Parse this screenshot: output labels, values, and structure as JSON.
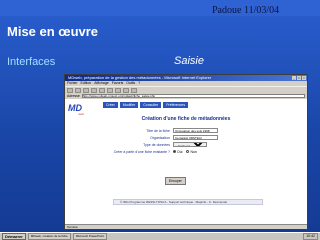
{
  "slide": {
    "stamp": "Padoue   11/03/04",
    "title": "Mise en œuvre",
    "subtitle": "Interfaces",
    "section": "Saisie"
  },
  "browser": {
    "title": "MDweb, préparation de la gestion des métadonnées - Microsoft Internet Explorer",
    "menu": [
      "Fichier",
      "Edition",
      "Affichage",
      "Favoris",
      "Outils",
      "?"
    ],
    "address_label": "Adresse",
    "address": "http://www.mdweb-project.org/mdweb/fiche_saisie.php",
    "status": "Terminé"
  },
  "app": {
    "logo_main": "MD",
    "logo_sub": "web",
    "nav": [
      "Créer",
      "Modifier",
      "Consulter",
      "Préférences"
    ],
    "form_title": "Création d'une fiche de métadonnées",
    "fields": [
      {
        "label": "Titre de la fiche",
        "value": "Occupation des sols 1998"
      },
      {
        "label": "Organisation",
        "value": "Cemagref (IRSTEA)"
      },
      {
        "label": "Type de données",
        "value": "Carte numérique"
      }
    ],
    "copy_label": "Créer à partir d'une fiche existante ?",
    "radio_yes": "Oui",
    "radio_no": "Non",
    "submit": "Envoyer",
    "footer": "© IMG Programme RESSI-TOSCA - Support technique : Mapinfo - K. Desmurais"
  },
  "taskbar": {
    "start": "Démarrer",
    "tasks": [
      "MDweb, création de la fiche",
      "Microsoft PowerPoint"
    ],
    "clock": "10:42"
  }
}
